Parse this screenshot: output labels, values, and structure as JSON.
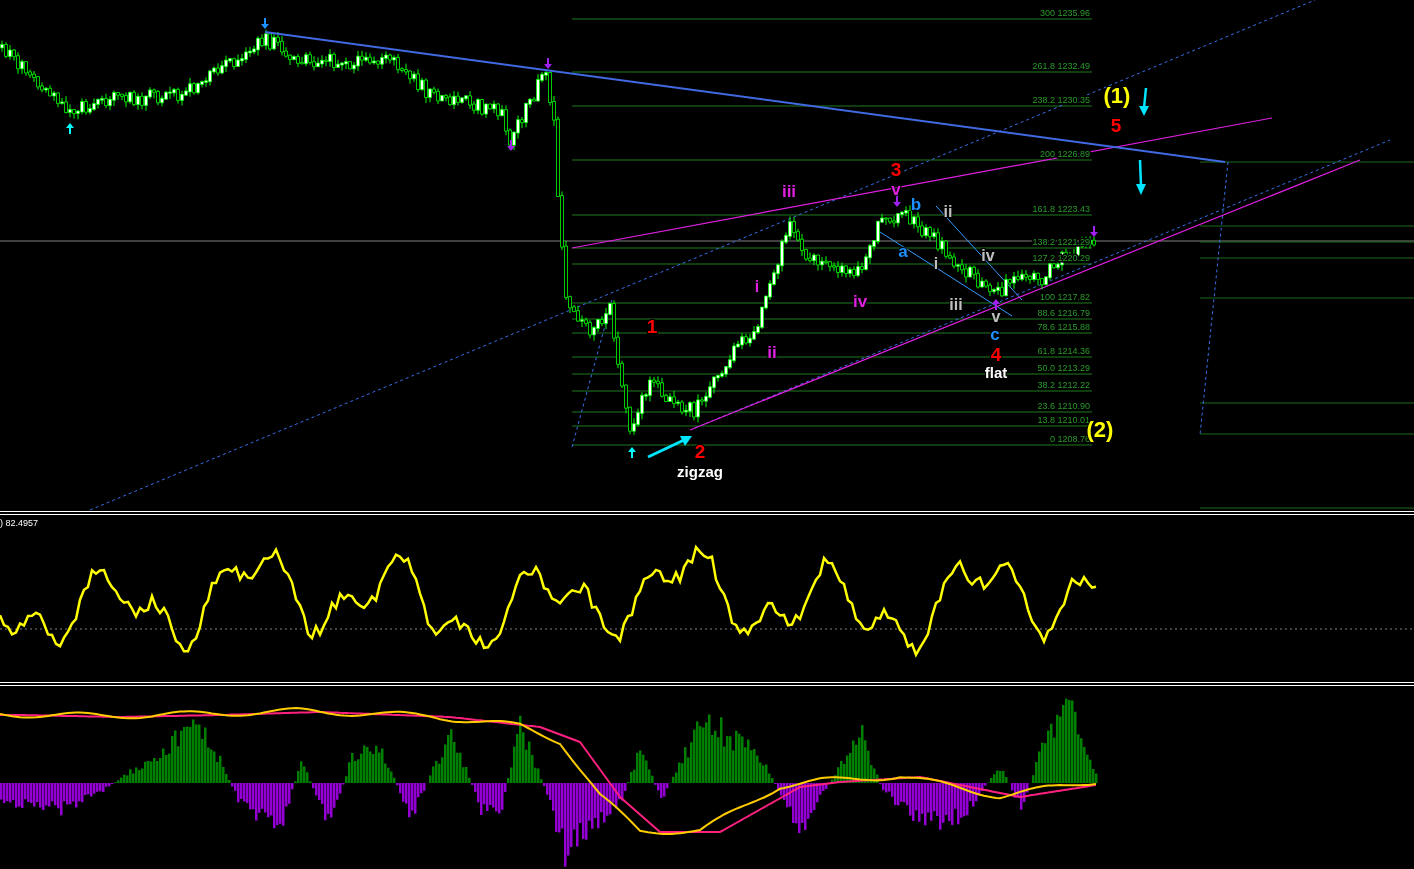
{
  "main_chart": {
    "fib_levels": [
      {
        "ratio": "300",
        "price": "1235.96"
      },
      {
        "ratio": "261.8",
        "price": "1232.49"
      },
      {
        "ratio": "238.2",
        "price": "1230.35"
      },
      {
        "ratio": "200",
        "price": "1226.89"
      },
      {
        "ratio": "161.8",
        "price": "1223.43"
      },
      {
        "ratio": "138.2",
        "price": "1221.29"
      },
      {
        "ratio": "127.2",
        "price": "1220.29"
      },
      {
        "ratio": "100",
        "price": "1217.82"
      },
      {
        "ratio": "88.6",
        "price": "1216.79"
      },
      {
        "ratio": "78.6",
        "price": "1215.88"
      },
      {
        "ratio": "61.8",
        "price": "1214.36"
      },
      {
        "ratio": "50.0",
        "price": "1213.29"
      },
      {
        "ratio": "38.2",
        "price": "1212.22"
      },
      {
        "ratio": "23.6",
        "price": "1210.90"
      },
      {
        "ratio": "13.8",
        "price": "1210.01"
      },
      {
        "ratio": "0",
        "price": "1208.76"
      }
    ],
    "wave_labels": [
      {
        "text": "(1)",
        "color": "#ffff00"
      },
      {
        "text": "5",
        "color": "#ff0000"
      },
      {
        "text": "3",
        "color": "#ff0000"
      },
      {
        "text": "v",
        "color": "#e020e0"
      },
      {
        "text": "b",
        "color": "#1e90ff"
      },
      {
        "text": "ii",
        "color": "#c0c0c0"
      },
      {
        "text": "iii",
        "color": "#e020e0"
      },
      {
        "text": "a",
        "color": "#1e90ff"
      },
      {
        "text": "i",
        "color": "#c0c0c0"
      },
      {
        "text": "iv",
        "color": "#c0c0c0"
      },
      {
        "text": "i",
        "color": "#e020e0"
      },
      {
        "text": "iv",
        "color": "#e020e0"
      },
      {
        "text": "iii",
        "color": "#c0c0c0"
      },
      {
        "text": "v",
        "color": "#c0c0c0"
      },
      {
        "text": "c",
        "color": "#1e90ff"
      },
      {
        "text": "4",
        "color": "#ff0000"
      },
      {
        "text": "flat",
        "color": "#ffffff"
      },
      {
        "text": "1",
        "color": "#ff0000"
      },
      {
        "text": "ii",
        "color": "#e020e0"
      },
      {
        "text": "2",
        "color": "#ff0000"
      },
      {
        "text": "zigzag",
        "color": "#ffffff"
      },
      {
        "text": "(2)",
        "color": "#ffff00"
      }
    ]
  },
  "oscillator": {
    "value_label": ") 82.4957"
  }
}
